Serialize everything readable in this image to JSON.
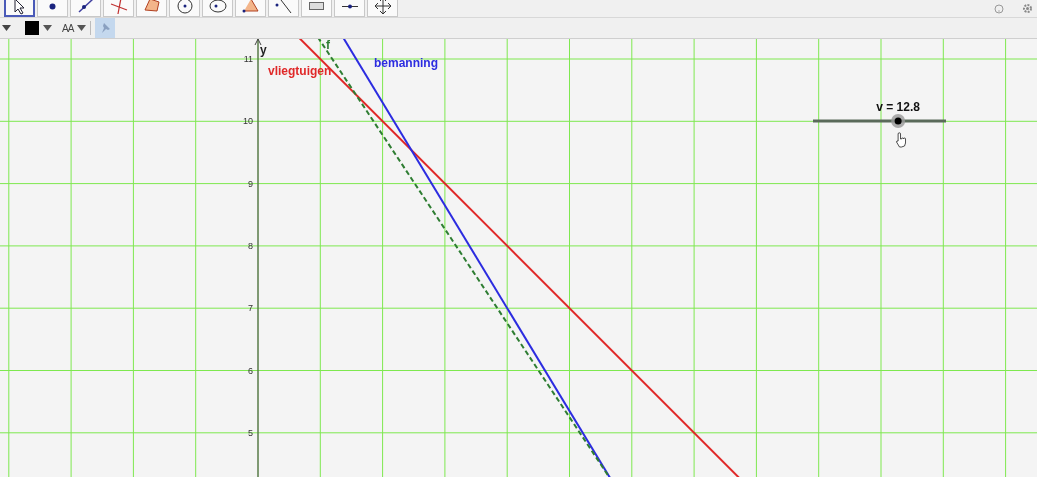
{
  "toolbar": {
    "tools": [
      {
        "kind": "move",
        "selected": true
      },
      {
        "kind": "point",
        "selected": false
      },
      {
        "kind": "line",
        "selected": false
      },
      {
        "kind": "perpendicular",
        "selected": false
      },
      {
        "kind": "polygon",
        "selected": false
      },
      {
        "kind": "circle",
        "selected": false
      },
      {
        "kind": "conic",
        "selected": false
      },
      {
        "kind": "angle",
        "selected": false
      },
      {
        "kind": "reflect",
        "selected": false
      },
      {
        "kind": "text",
        "selected": false
      },
      {
        "kind": "slider",
        "selected": false
      },
      {
        "kind": "pan",
        "selected": false
      }
    ]
  },
  "style_bar": {
    "color": "#000000",
    "text_size": "AA",
    "pin_selected": true
  },
  "graphics": {
    "y_axis": {
      "label": "y",
      "tick_labels": [
        "11",
        "10",
        "9",
        "8",
        "7",
        "6",
        "5"
      ]
    },
    "lines": [
      {
        "label": "vliegtuigen",
        "color": "#e02828",
        "kind": "solid"
      },
      {
        "label": "bemanning",
        "color": "#2c2ce0",
        "kind": "solid"
      },
      {
        "label": "f",
        "color": "#2e7d32",
        "kind": "dashed"
      }
    ],
    "slider": {
      "label": "v = 12.8",
      "level": 0.64
    }
  }
}
